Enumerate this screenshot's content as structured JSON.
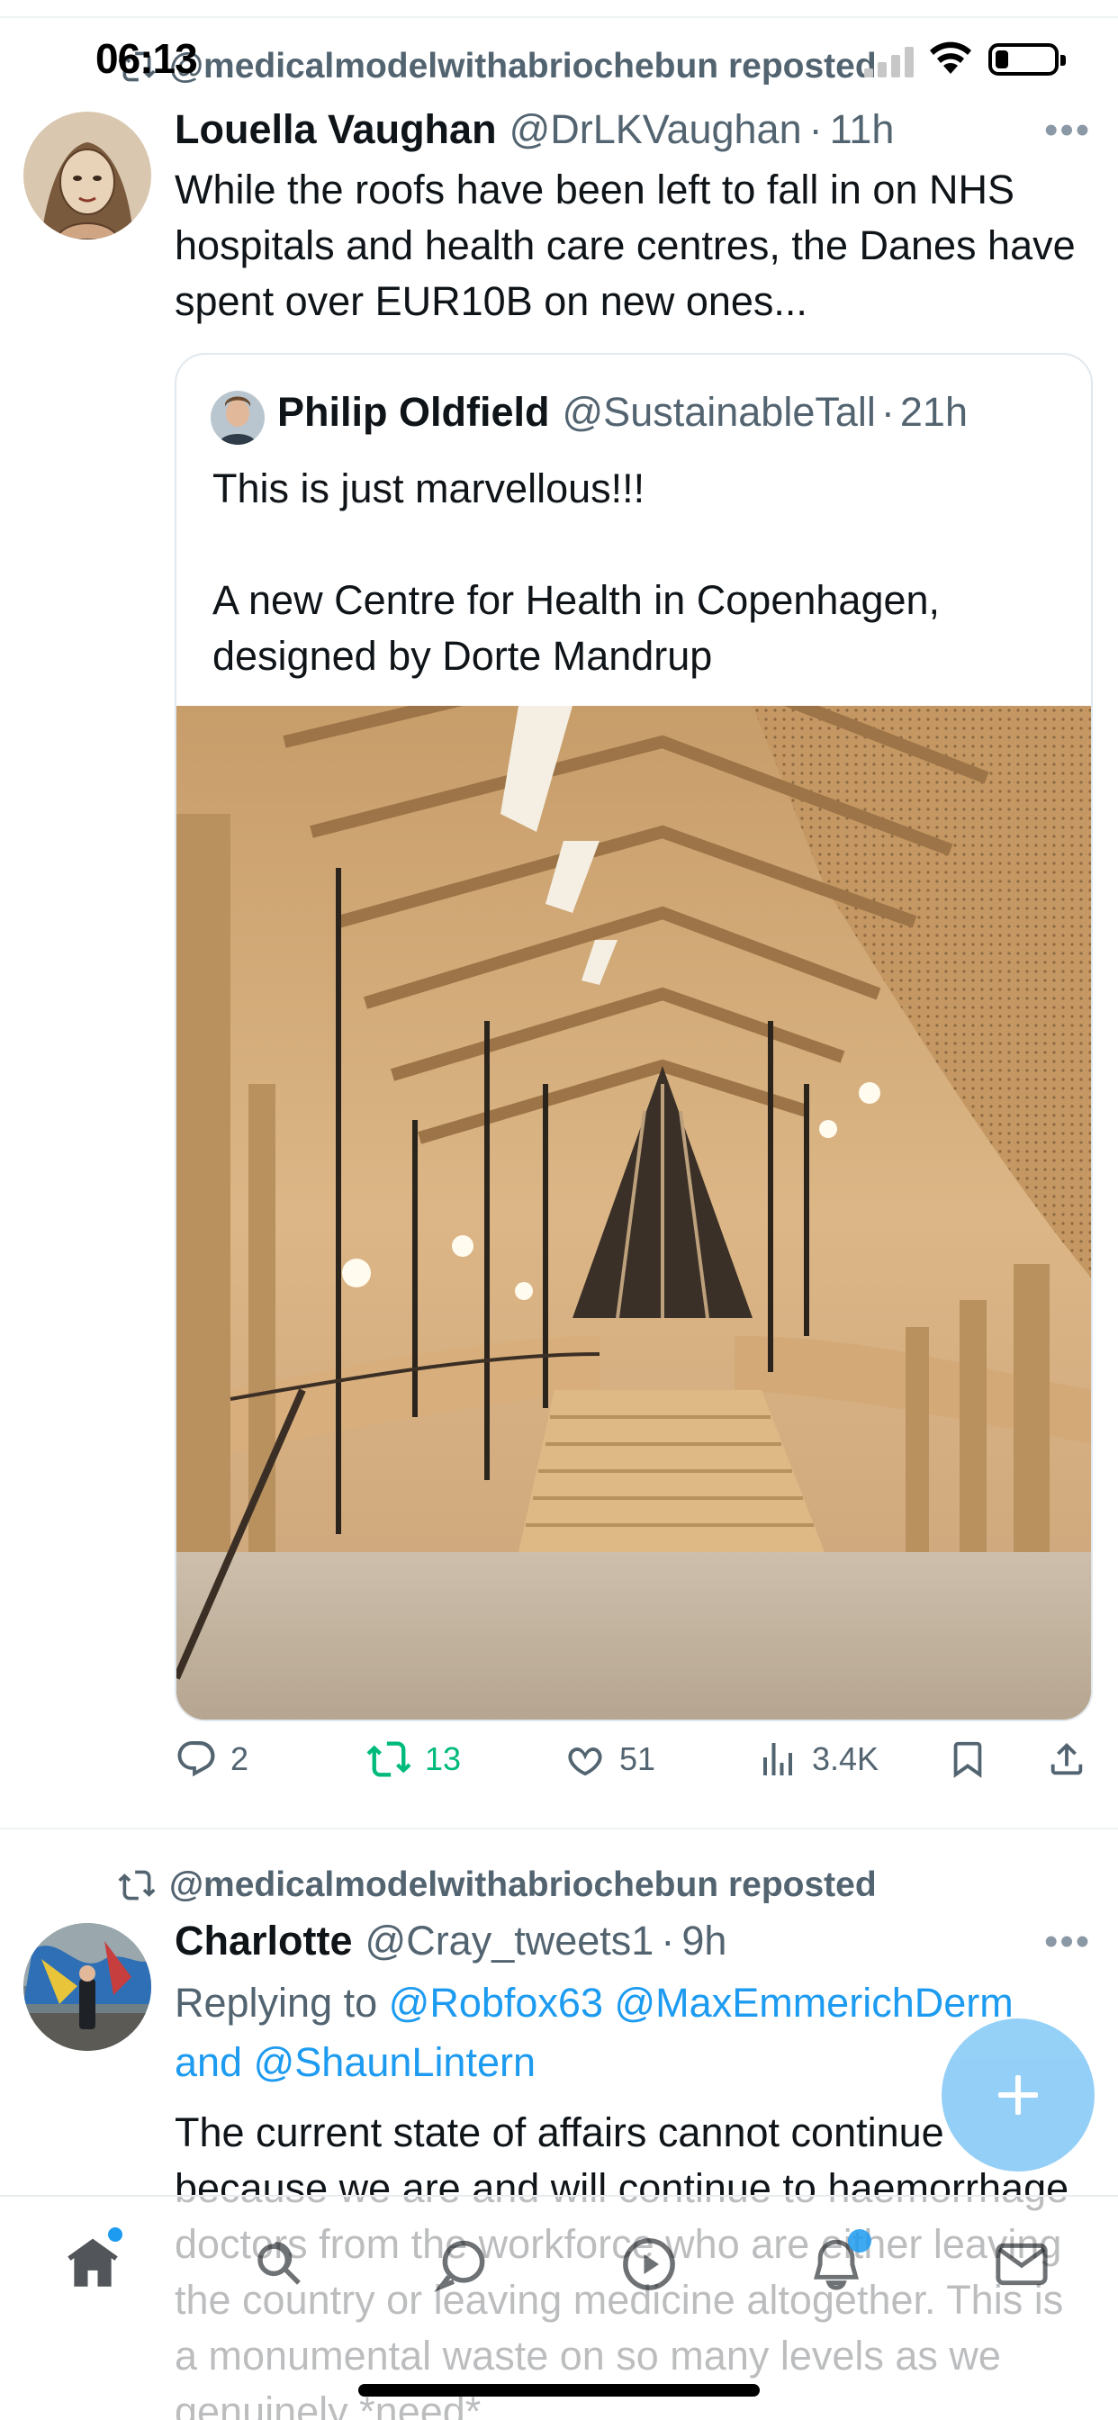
{
  "status_bar": {
    "time": "06:13"
  },
  "tweet1": {
    "repost_label": "@medicalmodelwithabriochebun reposted",
    "author_name": "Louella Vaughan",
    "author_handle": "@DrLKVaughan",
    "separator": "·",
    "age": "11h",
    "text": "While the roofs have been left to fall in on NHS hospitals and health care centres, the Danes have spent over EUR10B on new ones...",
    "quote": {
      "author_name": "Philip Oldfield",
      "author_handle": "@SustainableTall",
      "separator": "·",
      "age": "21h",
      "text": "This is just marvellous!!!\n\nA new Centre for Health in Copenhagen, designed by Dorte Mandrup"
    },
    "actions": {
      "replies": "2",
      "reposts": "13",
      "likes": "51",
      "views": "3.4K"
    }
  },
  "tweet2": {
    "repost_label": "@medicalmodelwithabriochebun reposted",
    "author_name": "Charlotte",
    "author_handle": "@Cray_tweets1",
    "separator": "·",
    "age": "9h",
    "replying_prefix": "Replying to",
    "mention1": "@Robfox63",
    "mention2": "@MaxEmmerichDerm",
    "and_word": "and",
    "mention3": "@ShaunLintern",
    "text": "The current state of affairs cannot continue because we are and will continue to haemorrhage doctors from the workforce who are either leaving the country or leaving medicine altogether. This is a monumental waste on so many levels as we genuinely *need*"
  },
  "icons": {
    "repost": "repost-icon",
    "reply": "reply-icon",
    "like": "heart-icon",
    "views": "views-icon",
    "bookmark": "bookmark-icon",
    "share": "share-icon",
    "compose": "plus-icon",
    "nav": [
      "home-icon",
      "search-icon",
      "spaces-icon",
      "video-icon",
      "bell-icon",
      "mail-icon"
    ]
  },
  "colors": {
    "accent": "#1d9bf0",
    "repost_active": "#00ba7c",
    "secondary_text": "#536471",
    "fab": "#8fcdf7"
  }
}
